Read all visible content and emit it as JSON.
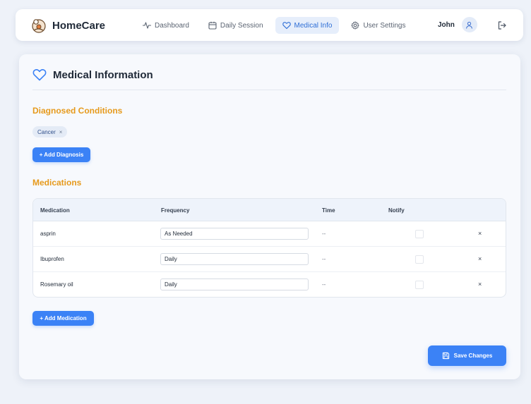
{
  "brand": {
    "name": "HomeCare"
  },
  "nav": {
    "items": [
      {
        "label": "Dashboard",
        "icon": "activity-icon",
        "active": false
      },
      {
        "label": "Daily Session",
        "icon": "calendar-icon",
        "active": false
      },
      {
        "label": "Medical Info",
        "icon": "heart-icon",
        "active": true
      },
      {
        "label": "User Settings",
        "icon": "gear-icon",
        "active": false
      }
    ]
  },
  "user": {
    "name": "John"
  },
  "page": {
    "title": "Medical Information"
  },
  "diagnoses": {
    "section_title": "Diagnosed Conditions",
    "items": [
      {
        "label": "Cancer",
        "remove": "×"
      }
    ],
    "add_label": "+ Add Diagnosis"
  },
  "medications": {
    "section_title": "Medications",
    "columns": [
      "Medication",
      "Frequency",
      "Time",
      "Notify"
    ],
    "rows": [
      {
        "name": "asprin",
        "frequency": "As Needed",
        "time": "--",
        "notify": false,
        "delete": "×"
      },
      {
        "name": "Ibuprofen",
        "frequency": "Daily",
        "time": "--",
        "notify": false,
        "delete": "×"
      },
      {
        "name": "Rosemary oil",
        "frequency": "Daily",
        "time": "--",
        "notify": false,
        "delete": "×"
      }
    ],
    "add_label": "+ Add Medication"
  },
  "actions": {
    "save_label": "Save Changes"
  },
  "colors": {
    "accent": "#3b82f6",
    "section_title": "#e69a1c",
    "nav_active_bg": "#e6eefb",
    "nav_active_text": "#2f6fd6"
  }
}
